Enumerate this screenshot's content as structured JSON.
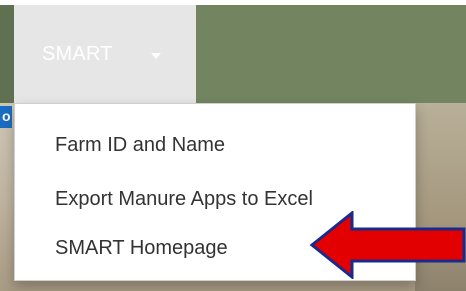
{
  "navbar": {
    "menu_label": "SMART",
    "caret_icon": "caret-down-icon",
    "color": "#728560",
    "active_bg": "#e6e6e6"
  },
  "side_tab": {
    "text": "o"
  },
  "dropdown": {
    "items": [
      {
        "label": "Farm ID and Name"
      },
      {
        "label": "Export Manure Apps to Excel"
      },
      {
        "label": "SMART Homepage"
      }
    ]
  },
  "annotation": {
    "icon": "red-arrow-icon",
    "color": "#e30000"
  }
}
